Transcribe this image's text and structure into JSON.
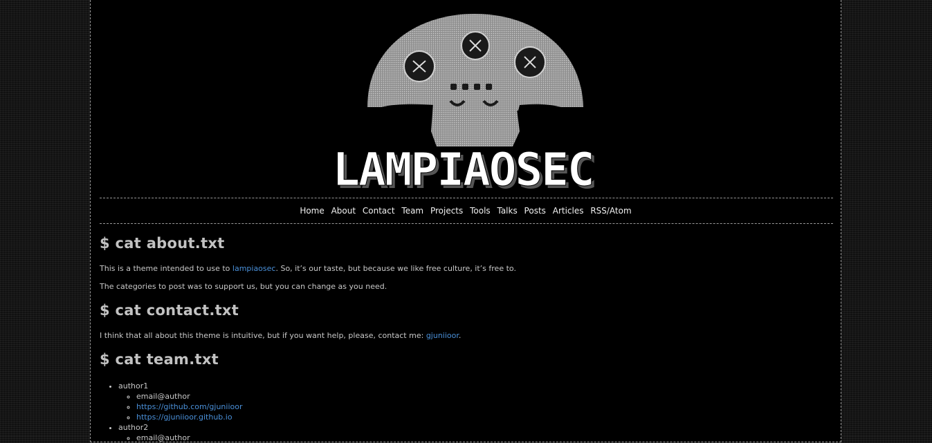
{
  "logo": {
    "wordmark": "LAMPIAOSEC"
  },
  "nav": [
    "Home",
    "About",
    "Contact",
    "Team",
    "Projects",
    "Tools",
    "Talks",
    "Posts",
    "Articles",
    "RSS/Atom"
  ],
  "about": {
    "heading": "$ cat about.txt",
    "p1_pre": "This is a theme intended to use to ",
    "p1_link": "lampiaosec",
    "p1_post": ". So, it’s our taste, but because we like free culture, it’s free to.",
    "p2": "The categories to post was to support us, but you can change as you need."
  },
  "contact": {
    "heading": "$ cat contact.txt",
    "p_pre": "I think that all about this theme is intuitive, but if you want help, please, contact me: ",
    "p_link": "gjuniioor",
    "p_post": "."
  },
  "team": {
    "heading": "$ cat team.txt",
    "members": [
      {
        "name": "author1",
        "email": "email@author",
        "links": [
          "https://github.com/gjuniioor",
          "https://gjuniioor.github.io"
        ]
      },
      {
        "name": "author2",
        "email": "email@author"
      }
    ]
  }
}
